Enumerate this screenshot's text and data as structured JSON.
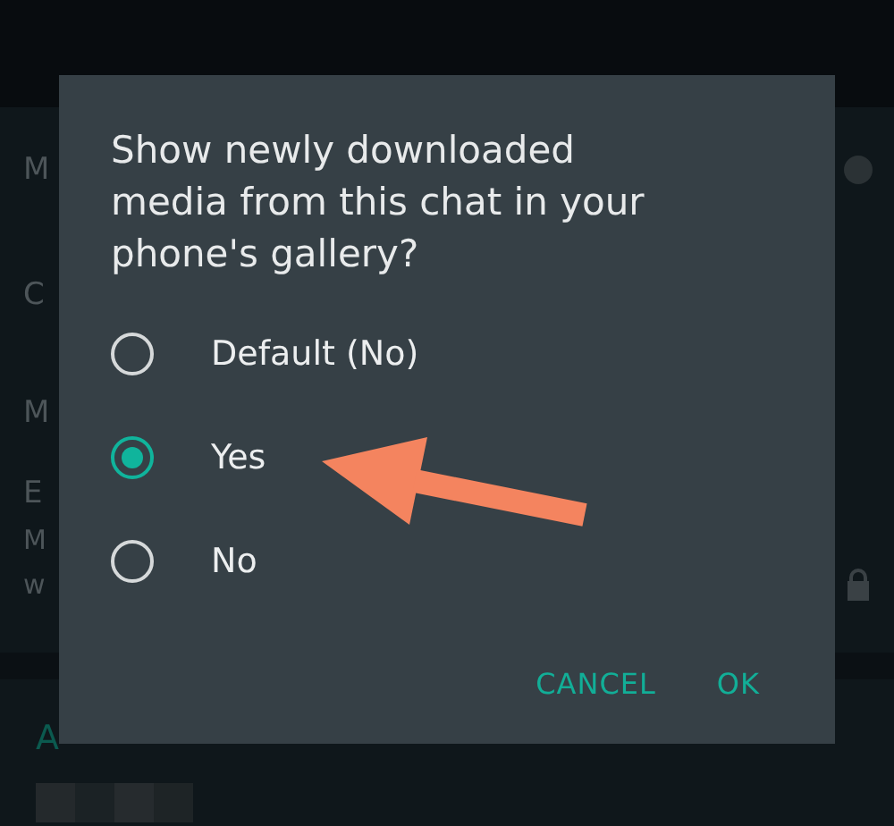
{
  "background": {
    "items": [
      {
        "text": "M",
        "kind": "toggle"
      },
      {
        "text": "C",
        "kind": "plain"
      },
      {
        "text": "M",
        "kind": "plain"
      },
      {
        "text": "E",
        "kind": "title"
      },
      {
        "text": "M",
        "kind": "subtitle"
      },
      {
        "text": "w",
        "kind": "subtitle-lock"
      }
    ],
    "section_title": "A"
  },
  "dialog": {
    "title": "Show newly downloaded media from this chat in your phone's gallery?",
    "options": [
      {
        "label": "Default (No)",
        "selected": false
      },
      {
        "label": "Yes",
        "selected": true
      },
      {
        "label": "No",
        "selected": false
      }
    ],
    "buttons": [
      "CANCEL",
      "OK"
    ]
  }
}
